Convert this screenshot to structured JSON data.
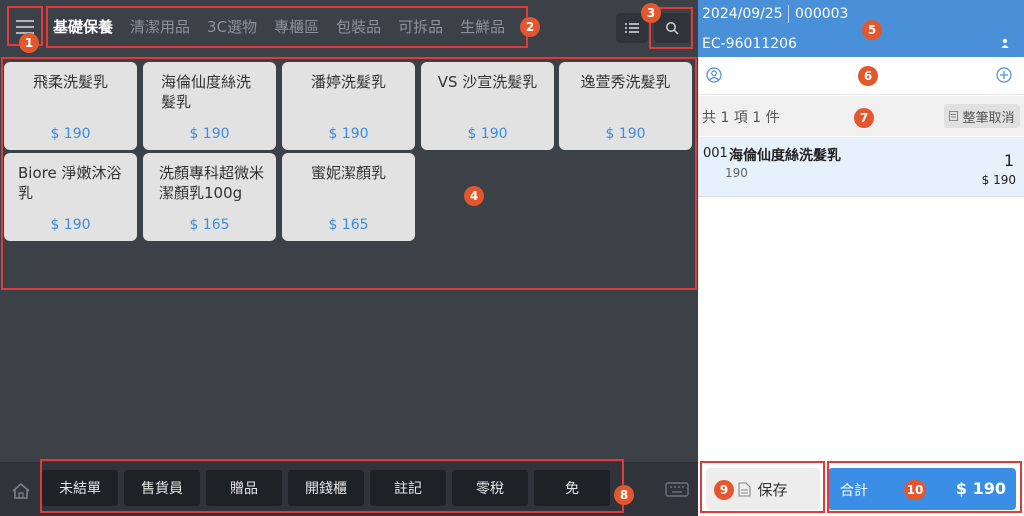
{
  "tabs": [
    "基礎保養",
    "清潔用品",
    "3C選物",
    "專櫃區",
    "包裝品",
    "可拆品",
    "生鮮品"
  ],
  "products": [
    {
      "name": "飛柔洗髮乳",
      "price": "$ 190"
    },
    {
      "name": "海倫仙度絲洗髮乳",
      "price": "$ 190"
    },
    {
      "name": "潘婷洗髮乳",
      "price": "$ 190"
    },
    {
      "name": "VS 沙宣洗髮乳",
      "price": "$ 190"
    },
    {
      "name": "逸萱秀洗髮乳",
      "price": "$ 190"
    },
    {
      "name": "Biore 淨嫩沐浴乳",
      "price": "$ 190"
    },
    {
      "name": "洗顏專科超微米潔顏乳100g",
      "price": "$ 165"
    },
    {
      "name": "蜜妮潔顏乳",
      "price": "$ 165"
    }
  ],
  "function_buttons": [
    "未結單",
    "售貨員",
    "贈品",
    "開錢櫃",
    "註記",
    "零稅",
    "免"
  ],
  "order": {
    "date": "2024/09/25",
    "number": "000003",
    "code": "EC-96011206",
    "summary": "共 1 項 1 件",
    "cancel_all_label": "整筆取消",
    "items": [
      {
        "index": "001",
        "name": "海倫仙度絲洗髮乳",
        "unit_price": "190",
        "qty": "1",
        "subtotal": "$ 190"
      }
    ]
  },
  "save_label": "保存",
  "total_label": "合計",
  "total_value": "$ 190",
  "badges": [
    "1",
    "2",
    "3",
    "4",
    "5",
    "6",
    "7",
    "8",
    "9",
    "10"
  ],
  "colors": {
    "accent": "#3a8ee6",
    "annotation": "#e03a3a",
    "badge": "#e4572e",
    "dark_bg": "#3c4148"
  }
}
